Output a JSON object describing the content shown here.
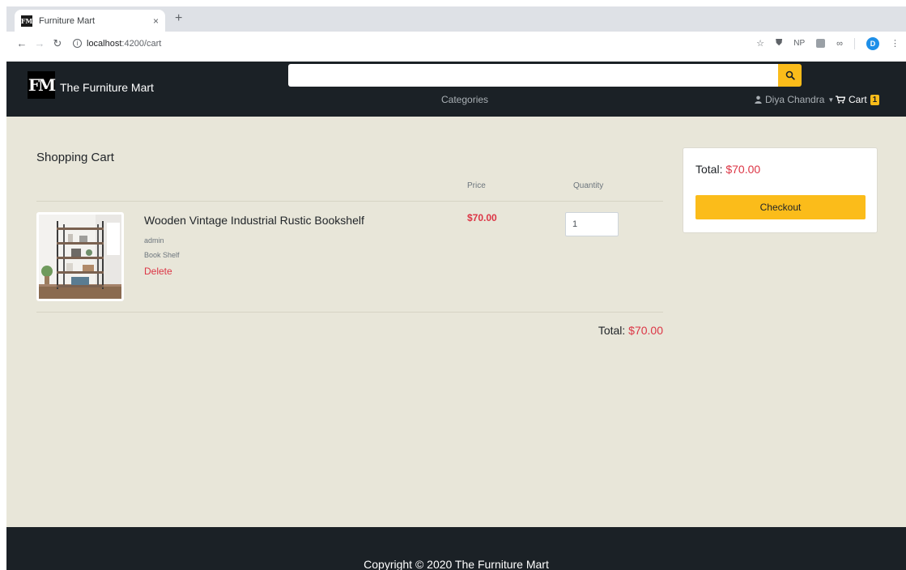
{
  "browser": {
    "tab_title": "Furniture Mart",
    "tab_close": "×",
    "new_tab": "+",
    "url_host": "localhost",
    "url_path": ":4200/cart",
    "ext_np": "NP",
    "profile_initial": "D"
  },
  "header": {
    "logo_text": "FM",
    "brand": "The Furniture Mart",
    "search_placeholder": "",
    "categories": "Categories",
    "user_name": "Diya Chandra",
    "cart_label": "Cart",
    "cart_count": "1"
  },
  "cart": {
    "title": "Shopping Cart",
    "col_price": "Price",
    "col_quantity": "Quantity",
    "items": [
      {
        "name": "Wooden Vintage Industrial Rustic Bookshelf",
        "seller": "admin",
        "category": "Book Shelf",
        "delete_label": "Delete",
        "price": "$70.00",
        "quantity": "1"
      }
    ],
    "total_label": "Total:",
    "total_value": "$70.00"
  },
  "summary": {
    "total_label": "Total:",
    "total_value": "$70.00",
    "checkout_label": "Checkout"
  },
  "footer": {
    "copyright": "Copyright © 2020 The Furniture Mart"
  },
  "colors": {
    "accent": "#fbbc1a",
    "danger": "#dc3545",
    "header_bg": "#1b2126",
    "page_bg": "#e8e6d9"
  }
}
